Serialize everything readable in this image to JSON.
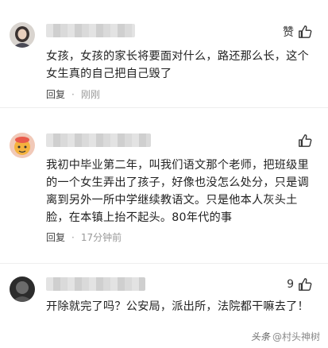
{
  "comments": [
    {
      "text": "女孩，女孩的家长将要面对什么，路还那么长，这个女生真的自己把自己毁了",
      "like_label": "赞",
      "reply_label": "回复",
      "time": "刚刚"
    },
    {
      "text": "我初中毕业第二年，叫我们语文那个老师，把班级里的一个女生弄出了孩子，好像也没怎么处分，只是调离到另外一所中学继续教语文。只是他本人灰头土脸，在本镇上抬不起头。80年代的事",
      "like_label": "",
      "reply_label": "回复",
      "time": "17分钟前"
    },
    {
      "text": "开除就完了吗？公安局，派出所，法院都干嘛去了！",
      "like_label": "9",
      "reply_label": "回复",
      "time": ""
    }
  ],
  "separator": "·",
  "watermark": {
    "platform": "头条",
    "handle": "@村头神树"
  },
  "colors": {
    "text": "#222222",
    "meta": "#999999",
    "divider": "#eeeeee"
  },
  "icons": [
    "thumbs-up-icon",
    "user-avatar-icon"
  ]
}
